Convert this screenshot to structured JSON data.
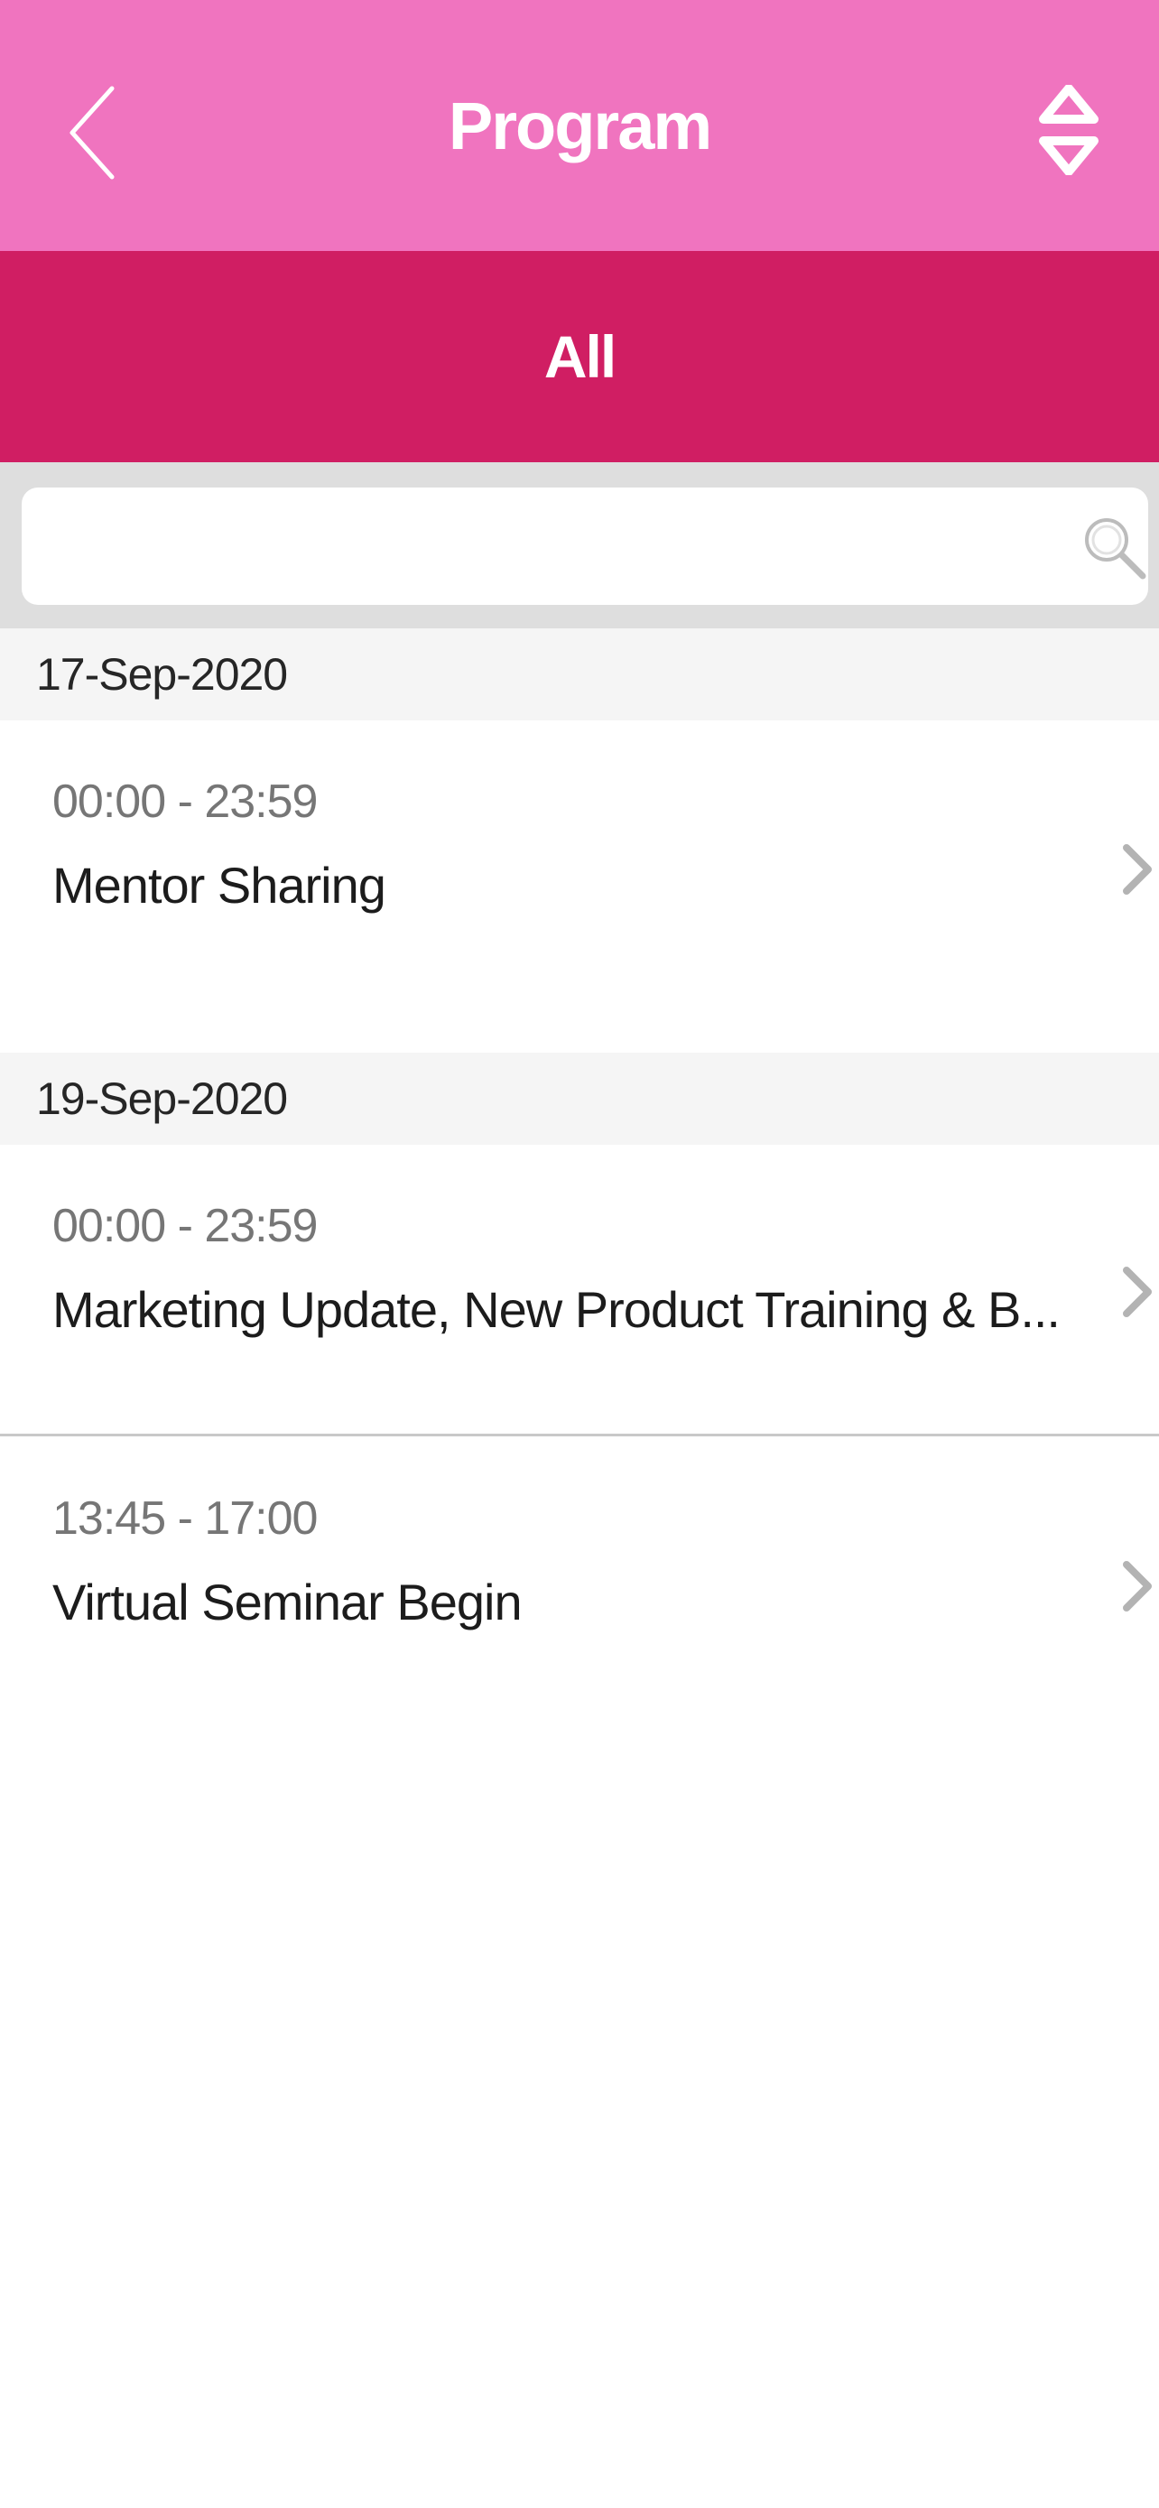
{
  "header": {
    "title": "Program",
    "back_icon": "chevron-left-icon",
    "sort_icon": "sort-up-down-icon",
    "background_color": "#f074bf"
  },
  "tabs": {
    "active_label": "All",
    "background_color": "#d01e63"
  },
  "search": {
    "value": "",
    "placeholder": "",
    "icon": "search-icon"
  },
  "groups": [
    {
      "date": "17-Sep-2020",
      "sessions": [
        {
          "time": "00:00 - 23:59",
          "title": "Mentor Sharing"
        }
      ]
    },
    {
      "date": "19-Sep-2020",
      "sessions": [
        {
          "time": "00:00 - 23:59",
          "title": "Marketing Update, New Product Training & B..."
        },
        {
          "time": "13:45 - 17:00",
          "title": "Virtual Seminar Begin"
        }
      ]
    }
  ]
}
